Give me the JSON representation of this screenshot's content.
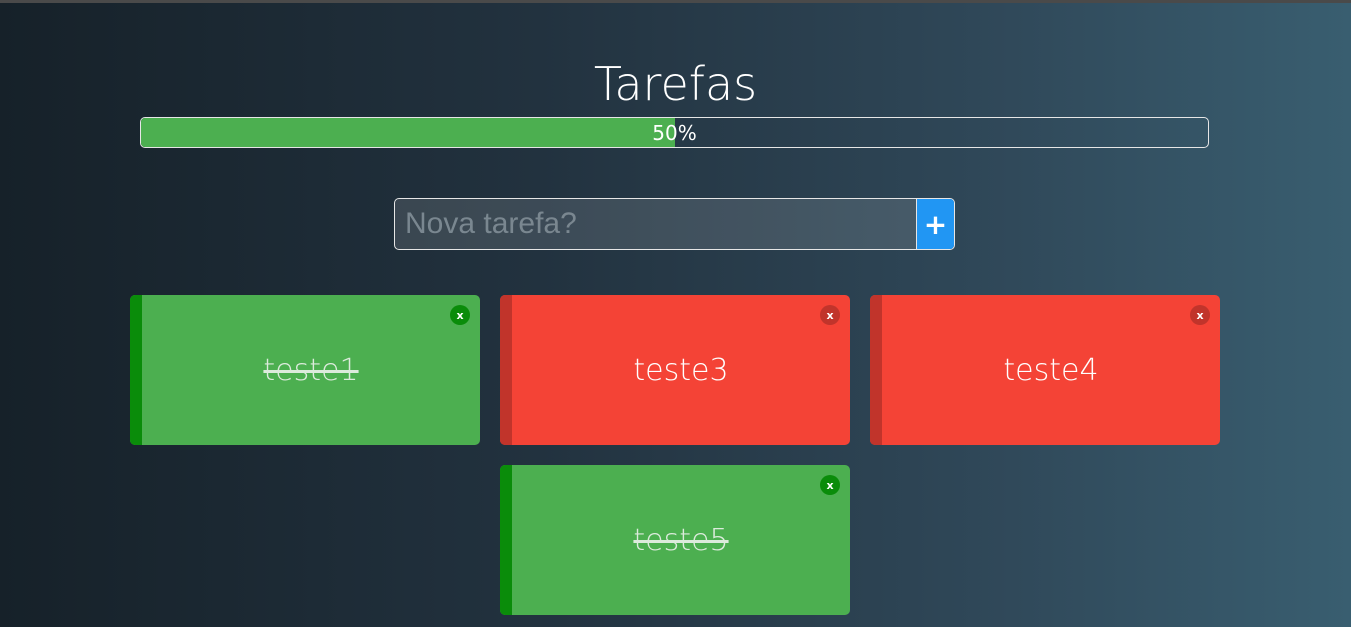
{
  "title": "Tarefas",
  "progress": {
    "value_percent": 50,
    "label": "50%"
  },
  "new_task": {
    "placeholder": "Nova tarefa?",
    "value": "",
    "add_label": "+"
  },
  "tasks": [
    {
      "label": "teste1",
      "done": true,
      "remove_label": "x"
    },
    {
      "label": "teste3",
      "done": false,
      "remove_label": "x"
    },
    {
      "label": "teste4",
      "done": false,
      "remove_label": "x"
    },
    {
      "label": "teste5",
      "done": true,
      "remove_label": "x"
    }
  ],
  "colors": {
    "done": "#4caf50",
    "pending": "#f44336",
    "add_button": "#2196f3"
  }
}
